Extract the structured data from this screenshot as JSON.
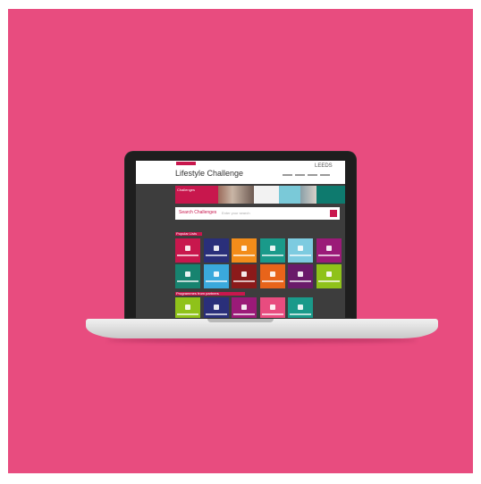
{
  "colors": {
    "background": "#e84c7f",
    "brand": "#c8174d",
    "screen_bg": "#3d3d3d"
  },
  "screen": {
    "header": {
      "title": "Lifestyle Challenge",
      "logo_text": "LEEDS"
    },
    "banner": {
      "label": "Challenges"
    },
    "search": {
      "label": "Search Challenges",
      "placeholder": "Enter your search"
    },
    "section_1_label": "Popular Lists",
    "section_2_label": "Programmes from partners"
  },
  "tiles_row_1": [
    {
      "color": "#c8174d",
      "icon": "heart-icon"
    },
    {
      "color": "#2a2f7a",
      "icon": "document-icon"
    },
    {
      "color": "#f28c1a",
      "icon": "cog-icon"
    },
    {
      "color": "#1a9a8a",
      "icon": "chat-icon"
    },
    {
      "color": "#7dcbe0",
      "icon": "screen-icon"
    },
    {
      "color": "#9b1a78",
      "icon": "person-icon"
    }
  ],
  "tiles_row_2": [
    {
      "color": "#17836f",
      "icon": "car-icon"
    },
    {
      "color": "#3aa9dc",
      "icon": "bike-icon"
    },
    {
      "color": "#8b1a1a",
      "icon": "chart-icon"
    },
    {
      "color": "#e8641a",
      "icon": "hand-icon"
    },
    {
      "color": "#6a1a6a",
      "icon": "star-icon"
    },
    {
      "color": "#8fc21a",
      "icon": "leaf-icon"
    }
  ],
  "tiles_row_3": [
    {
      "color": "#8fc21a",
      "icon": "apple-icon"
    },
    {
      "color": "#2a2f7a",
      "icon": "book-icon"
    },
    {
      "color": "#9b1a78",
      "icon": "cup-icon"
    },
    {
      "color": "#e84c7f",
      "icon": "walk-icon"
    },
    {
      "color": "#1a9a8a",
      "icon": "drop-icon"
    }
  ]
}
